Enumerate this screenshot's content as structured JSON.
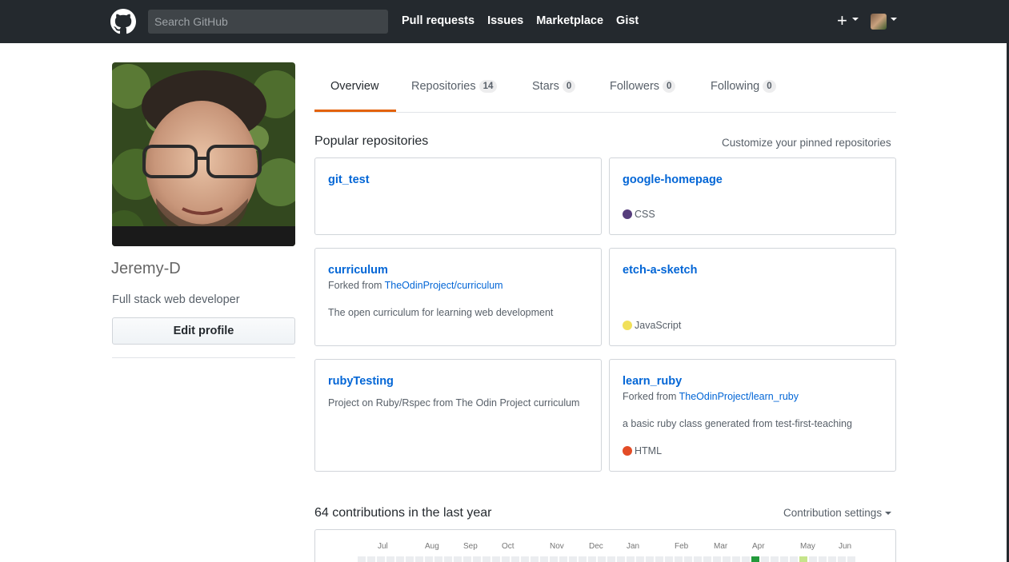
{
  "header": {
    "search_placeholder": "Search GitHub",
    "nav": [
      "Pull requests",
      "Issues",
      "Marketplace",
      "Gist"
    ],
    "plus_icon": "+"
  },
  "profile": {
    "username": "Jeremy-D",
    "bio": "Full stack web developer",
    "edit_label": "Edit profile"
  },
  "tabs": [
    {
      "label": "Overview",
      "count": null,
      "selected": true
    },
    {
      "label": "Repositories",
      "count": "14"
    },
    {
      "label": "Stars",
      "count": "0"
    },
    {
      "label": "Followers",
      "count": "0"
    },
    {
      "label": "Following",
      "count": "0"
    }
  ],
  "popular": {
    "title": "Popular repositories",
    "customize_link": "Customize your pinned repositories"
  },
  "repos": [
    {
      "name": "git_test"
    },
    {
      "name": "google-homepage",
      "language": "CSS",
      "language_color": "#563d7c"
    },
    {
      "name": "curriculum",
      "forked_prefix": "Forked from ",
      "forked_from": "TheOdinProject/curriculum",
      "description": "The open curriculum for learning web development"
    },
    {
      "name": "etch-a-sketch",
      "language": "JavaScript",
      "language_color": "#f1e05a"
    },
    {
      "name": "rubyTesting",
      "description": "Project on Ruby/Rspec from The Odin Project curriculum"
    },
    {
      "name": "learn_ruby",
      "forked_prefix": "Forked from ",
      "forked_from": "TheOdinProject/learn_ruby",
      "description": "a basic ruby class generated from test-first-teaching",
      "language": "HTML",
      "language_color": "#e34c26"
    }
  ],
  "contributions": {
    "title": "64 contributions in the last year",
    "settings_label": "Contribution settings",
    "months": [
      "Jul",
      "Aug",
      "Sep",
      "Oct",
      "Nov",
      "Dec",
      "Jan",
      "Feb",
      "Mar",
      "Apr",
      "May",
      "Jun"
    ],
    "colors": {
      "empty": "#ebedf0",
      "level_dark": "#239a3b",
      "level_light": "#c6e48b"
    }
  }
}
